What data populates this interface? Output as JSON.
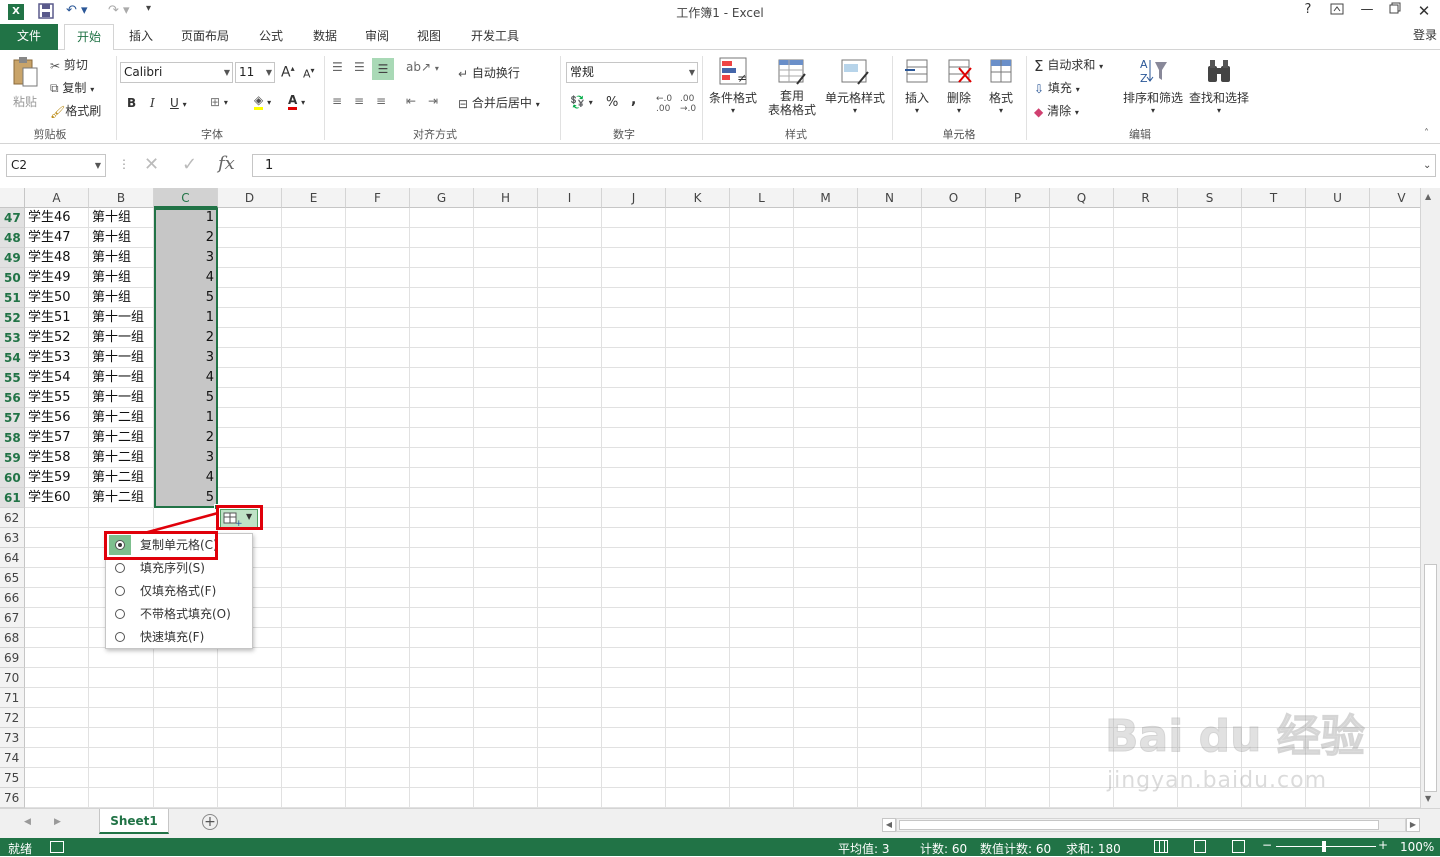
{
  "app": {
    "window_title": "工作簿1 - Excel",
    "login": "登录",
    "help": "?",
    "restore_ribbon": "□"
  },
  "tabs": [
    {
      "label": "文件"
    },
    {
      "label": "开始"
    },
    {
      "label": "插入"
    },
    {
      "label": "页面布局"
    },
    {
      "label": "公式"
    },
    {
      "label": "数据"
    },
    {
      "label": "审阅"
    },
    {
      "label": "视图"
    },
    {
      "label": "开发工具"
    }
  ],
  "ribbon": {
    "clipboard": {
      "paste": "粘贴",
      "cut": "剪切",
      "copy": "复制",
      "format_painter": "格式刷",
      "label": "剪贴板"
    },
    "font": {
      "name": "Calibri",
      "size": "11",
      "bold": "B",
      "italic": "I",
      "underline": "U",
      "label": "字体",
      "grow": "A",
      "shrink": "A"
    },
    "align": {
      "wrap": "自动换行",
      "merge": "合并后居中",
      "label": "对齐方式"
    },
    "number": {
      "format": "常规",
      "percent": "%",
      "comma": ",",
      "label": "数字"
    },
    "styles": {
      "conditional": "条件格式",
      "table_line1": "套用",
      "table_line2": "表格格式",
      "cell_styles": "单元格样式",
      "label": "样式"
    },
    "cells": {
      "insert": "插入",
      "delete": "删除",
      "format": "格式",
      "label": "单元格"
    },
    "editing": {
      "autosum": "自动求和",
      "fill": "填充",
      "clear": "清除",
      "sort": "排序和筛选",
      "find": "查找和选择",
      "label": "编辑"
    }
  },
  "formula_bar": {
    "name_box": "C2",
    "fx": "fx",
    "value": "1"
  },
  "columns": [
    "A",
    "B",
    "C",
    "D",
    "E",
    "F",
    "G",
    "H",
    "I",
    "J",
    "K",
    "L",
    "M",
    "N",
    "O",
    "P",
    "Q",
    "R",
    "S",
    "T",
    "U",
    "V"
  ],
  "rows": [
    {
      "num": "47",
      "a": "学生46",
      "b": "第十组",
      "c": "1"
    },
    {
      "num": "48",
      "a": "学生47",
      "b": "第十组",
      "c": "2"
    },
    {
      "num": "49",
      "a": "学生48",
      "b": "第十组",
      "c": "3"
    },
    {
      "num": "50",
      "a": "学生49",
      "b": "第十组",
      "c": "4"
    },
    {
      "num": "51",
      "a": "学生50",
      "b": "第十组",
      "c": "5"
    },
    {
      "num": "52",
      "a": "学生51",
      "b": "第十一组",
      "c": "1"
    },
    {
      "num": "53",
      "a": "学生52",
      "b": "第十一组",
      "c": "2"
    },
    {
      "num": "54",
      "a": "学生53",
      "b": "第十一组",
      "c": "3"
    },
    {
      "num": "55",
      "a": "学生54",
      "b": "第十一组",
      "c": "4"
    },
    {
      "num": "56",
      "a": "学生55",
      "b": "第十一组",
      "c": "5"
    },
    {
      "num": "57",
      "a": "学生56",
      "b": "第十二组",
      "c": "1"
    },
    {
      "num": "58",
      "a": "学生57",
      "b": "第十二组",
      "c": "2"
    },
    {
      "num": "59",
      "a": "学生58",
      "b": "第十二组",
      "c": "3"
    },
    {
      "num": "60",
      "a": "学生59",
      "b": "第十二组",
      "c": "4"
    },
    {
      "num": "61",
      "a": "学生60",
      "b": "第十二组",
      "c": "5"
    },
    {
      "num": "62",
      "a": "",
      "b": "",
      "c": ""
    },
    {
      "num": "63",
      "a": "",
      "b": "",
      "c": ""
    },
    {
      "num": "64",
      "a": "",
      "b": "",
      "c": ""
    },
    {
      "num": "65",
      "a": "",
      "b": "",
      "c": ""
    },
    {
      "num": "66",
      "a": "",
      "b": "",
      "c": ""
    },
    {
      "num": "67",
      "a": "",
      "b": "",
      "c": ""
    },
    {
      "num": "68",
      "a": "",
      "b": "",
      "c": ""
    },
    {
      "num": "69",
      "a": "",
      "b": "",
      "c": ""
    },
    {
      "num": "70",
      "a": "",
      "b": "",
      "c": ""
    },
    {
      "num": "71",
      "a": "",
      "b": "",
      "c": ""
    },
    {
      "num": "72",
      "a": "",
      "b": "",
      "c": ""
    },
    {
      "num": "73",
      "a": "",
      "b": "",
      "c": ""
    },
    {
      "num": "74",
      "a": "",
      "b": "",
      "c": ""
    },
    {
      "num": "75",
      "a": "",
      "b": "",
      "c": ""
    },
    {
      "num": "76",
      "a": "",
      "b": "",
      "c": ""
    }
  ],
  "autofill_menu": [
    {
      "label": "复制单元格(C)",
      "selected": true
    },
    {
      "label": "填充序列(S)",
      "selected": false
    },
    {
      "label": "仅填充格式(F)",
      "selected": false
    },
    {
      "label": "不带格式填充(O)",
      "selected": false
    },
    {
      "label": "快速填充(F)",
      "selected": false
    }
  ],
  "sheet_tabs": [
    {
      "label": "Sheet1"
    }
  ],
  "status": {
    "ready": "就绪",
    "average": "平均值: 3",
    "count": "计数: 60",
    "numeric_count": "数值计数: 60",
    "sum": "求和: 180",
    "zoom": "100%"
  },
  "watermark": {
    "text": "Bai du 经验",
    "url": "jingyan.baidu.com"
  },
  "colors": {
    "excel_green": "#217346",
    "selection": "#c6c6c6",
    "highlight": "#e0000a"
  }
}
